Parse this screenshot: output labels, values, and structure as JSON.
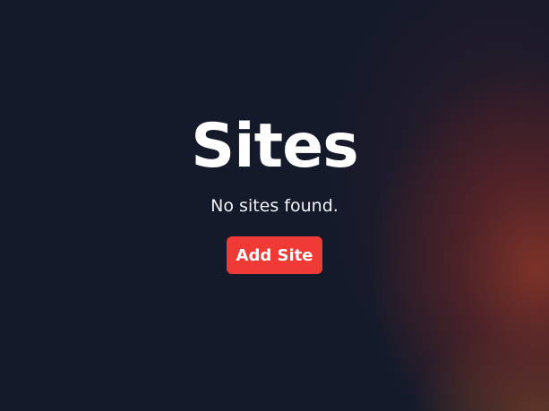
{
  "page": {
    "title": "Sites",
    "empty_message": "No sites found.",
    "add_button_label": "Add Site"
  },
  "colors": {
    "background": "#141a2a",
    "accent": "#f03a35",
    "text": "#ffffff"
  }
}
